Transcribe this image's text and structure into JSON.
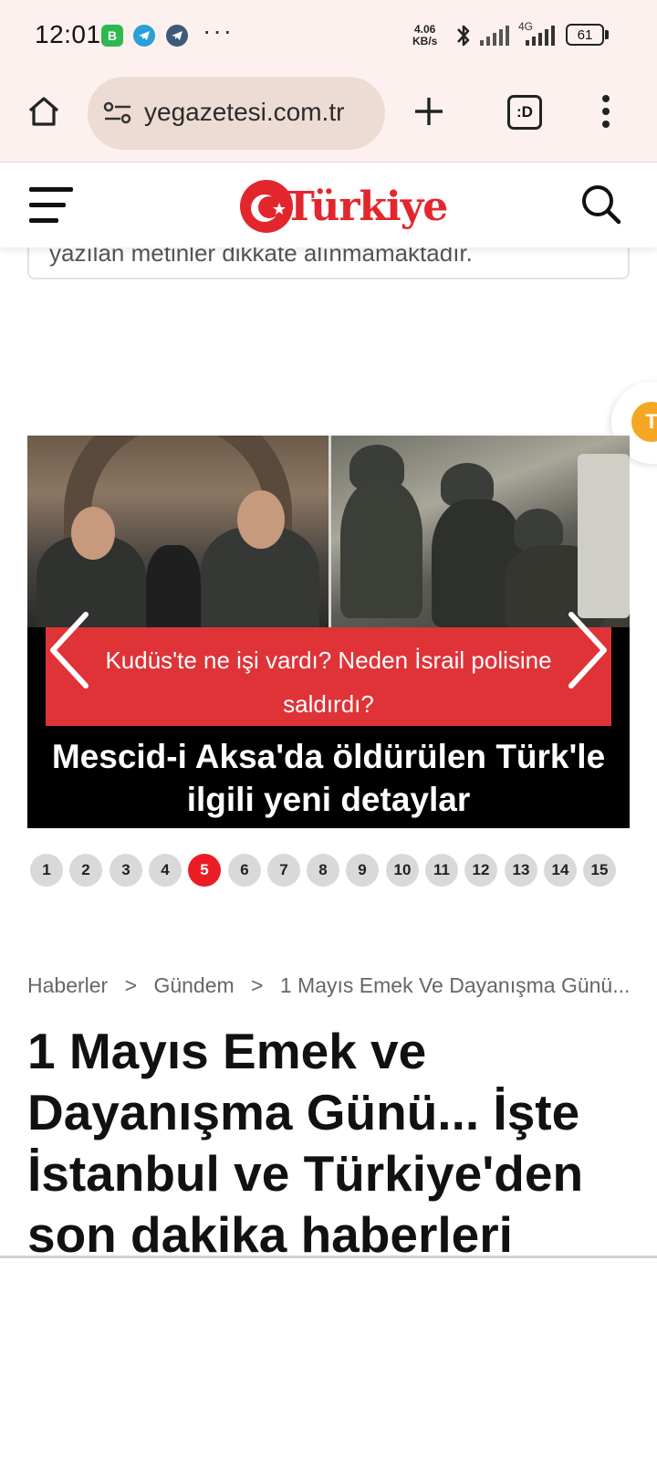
{
  "status_bar": {
    "time": "12:01",
    "more": "···",
    "net_speed_value": "4.06",
    "net_speed_unit": "KB/s",
    "network_type": "4G",
    "battery": "61",
    "icons": [
      "whatsapp-business-icon",
      "telegram-icon",
      "telegram-icon",
      "bluetooth-icon",
      "signal-icon",
      "signal-icon",
      "battery-icon"
    ]
  },
  "browser": {
    "url": "yegazetesi.com.tr",
    "tabs_label": ":D",
    "icons": [
      "home-icon",
      "site-settings-icon",
      "new-tab-icon",
      "tabs-icon",
      "menu-icon"
    ]
  },
  "header": {
    "logo_text": "Türkiye",
    "icons": [
      "hamburger-menu-icon",
      "search-icon"
    ]
  },
  "disclaimer": {
    "text": "yazılan metinler dikkate alınmamaktadır."
  },
  "slider": {
    "subtitle": "Kudüs'te ne işi vardı? Neden İsrail polisine saldırdı?",
    "title": "Mescid-i Aksa'da öldürülen Türk'le ilgili yeni detaylar",
    "pages": [
      "1",
      "2",
      "3",
      "4",
      "5",
      "6",
      "7",
      "8",
      "9",
      "10",
      "11",
      "12",
      "13",
      "14",
      "15"
    ],
    "active_page": "5",
    "colors": {
      "red_band": "#df3338",
      "active_dot": "#ec1c24"
    }
  },
  "breadcrumb": {
    "items": [
      "Haberler",
      "Gündem",
      "1 Mayıs Emek Ve Dayanışma Günü... ..."
    ],
    "separator": ">"
  },
  "article": {
    "headline": "1 Mayıs Emek ve Dayanışma Günü... İşte İstanbul ve Türkiye'den son dakika haberleri"
  }
}
